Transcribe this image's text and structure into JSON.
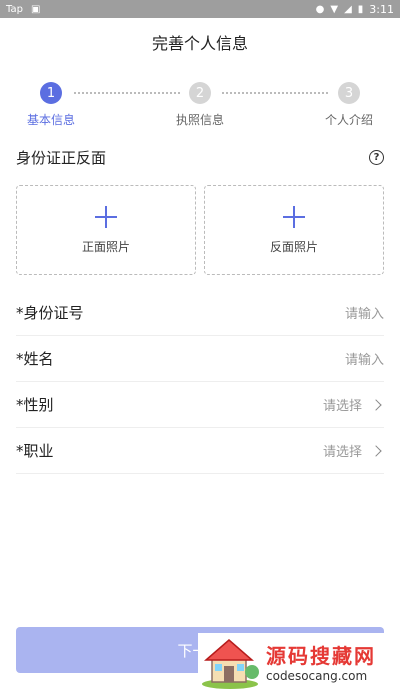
{
  "status_bar": {
    "left_text": "Tap",
    "time": "3:11"
  },
  "title": "完善个人信息",
  "steps": [
    {
      "number": "1",
      "label": "基本信息",
      "active": true
    },
    {
      "number": "2",
      "label": "执照信息",
      "active": false
    },
    {
      "number": "3",
      "label": "个人介绍",
      "active": false
    }
  ],
  "id_section": {
    "title": "身份证正反面",
    "help_icon": "?",
    "front_label": "正面照片",
    "back_label": "反面照片"
  },
  "form": {
    "id_number": {
      "label": "*身份证号",
      "placeholder": "请输入"
    },
    "name": {
      "label": "*姓名",
      "placeholder": "请输入"
    },
    "gender": {
      "label": "*性别",
      "placeholder": "请选择"
    },
    "job": {
      "label": "*职业",
      "placeholder": "请选择"
    }
  },
  "next_button": "下一步",
  "watermark": {
    "cn": "源码搜藏网",
    "url": "codesocang.com"
  },
  "colors": {
    "accent": "#5b6ee1",
    "button_disabled": "#aab4f0",
    "status_bar": "#9e9e9e"
  }
}
